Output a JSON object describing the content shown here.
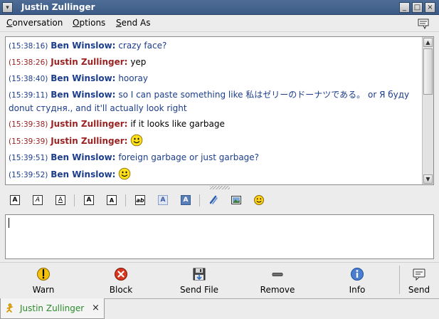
{
  "window": {
    "title": "Justin Zullinger",
    "controls": [
      "minimize",
      "maximize",
      "close"
    ]
  },
  "menu": {
    "conversation": "Conversation",
    "conversation_mnemonic": "C",
    "options": "Options",
    "options_mnemonic": "O",
    "send_as": "Send As",
    "send_as_mnemonic": "S"
  },
  "messages": [
    {
      "time": "(15:38:16)",
      "sender": "Ben Winslow:",
      "text": "crazy face?",
      "who": "ben"
    },
    {
      "time": "(15:38:26)",
      "sender": "Justin Zullinger:",
      "text": "yep",
      "who": "justin"
    },
    {
      "time": "(15:38:40)",
      "sender": "Ben Winslow:",
      "text": "hooray",
      "who": "ben"
    },
    {
      "time": "(15:39:11)",
      "sender": "Ben Winslow:",
      "text": "so I can paste something like 私はゼリーのドーナツである。 or Я буду donut студня., and it'll actually look right",
      "who": "ben"
    },
    {
      "time": "(15:39:38)",
      "sender": "Justin Zullinger:",
      "text": "if it looks like garbage",
      "who": "justin"
    },
    {
      "time": "(15:39:39)",
      "sender": "Justin Zullinger:",
      "text": "",
      "who": "justin",
      "smiley": true
    },
    {
      "time": "(15:39:51)",
      "sender": "Ben Winslow:",
      "text": "foreign garbage or just garbage?",
      "who": "ben"
    },
    {
      "time": "(15:39:52)",
      "sender": "Ben Winslow:",
      "text": "",
      "who": "ben",
      "smiley": true
    }
  ],
  "format_toolbar": {
    "bold": "A",
    "italic": "A",
    "underline": "A",
    "larger": "A",
    "smaller": "A",
    "font_face": "ab",
    "fg_color": "A",
    "bg_color": "A"
  },
  "entry": {
    "value": ""
  },
  "buttons": {
    "warn": "Warn",
    "block": "Block",
    "send_file": "Send File",
    "remove": "Remove",
    "info": "Info",
    "send": "Send"
  },
  "tab": {
    "label": "Justin Zullinger",
    "close": "×"
  },
  "colors": {
    "ben": "#1c3d8c",
    "justin": "#9a2222",
    "tab_label": "#2a8a2a",
    "titlebar": "#3b5a85"
  }
}
